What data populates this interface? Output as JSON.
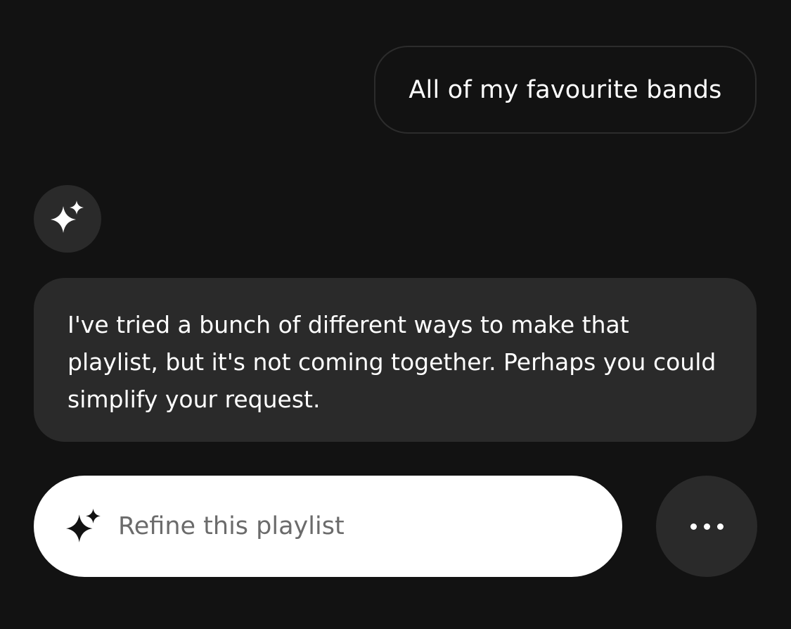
{
  "conversation": {
    "user_message": "All of my favourite bands",
    "assistant_message": "I've tried a bunch of different ways to make that playlist, but it's not coming together. Perhaps you could simplify your request."
  },
  "actions": {
    "refine_label": "Refine this playlist",
    "more_icon": "more-horizontal-icon",
    "assistant_icon": "sparkle-icon"
  },
  "colors": {
    "background": "#121212",
    "bubble": "#2a2a2a",
    "pill": "#ffffff",
    "pill_text": "#6b6b6b"
  }
}
